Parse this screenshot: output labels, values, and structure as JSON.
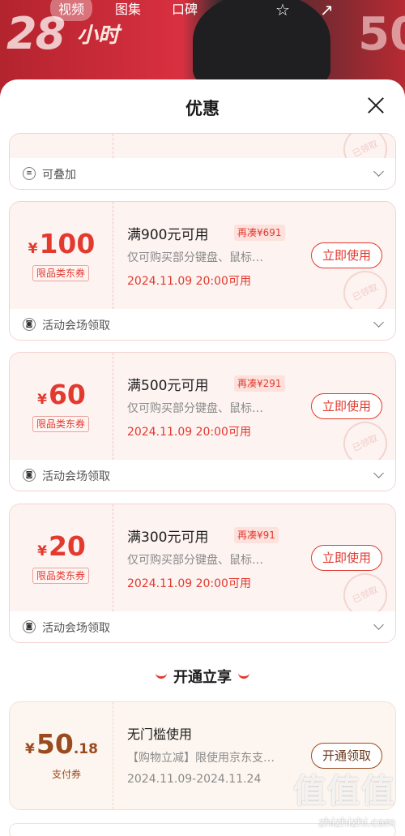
{
  "background": {
    "tabs": [
      "视频",
      "图集",
      "口碑"
    ],
    "promo_big": "28",
    "promo_sub": "小时",
    "right_number": "50"
  },
  "sheet": {
    "title": "优惠"
  },
  "top_partial": {
    "stamp": "已领取",
    "footer_text": "可叠加"
  },
  "coupons": [
    {
      "symbol": "¥",
      "amount": "100",
      "tag": "限品类东券",
      "condition": "满900元可用",
      "need": "再凑¥691",
      "desc": "仅可购买部分键盘、鼠标…",
      "date": "2024.11.09 20:00可用",
      "button": "立即使用",
      "stamp": "已领取",
      "footer_text": "活动会场领取"
    },
    {
      "symbol": "¥",
      "amount": "60",
      "tag": "限品类东券",
      "condition": "满500元可用",
      "need": "再凑¥291",
      "desc": "仅可购买部分键盘、鼠标…",
      "date": "2024.11.09 20:00可用",
      "button": "立即使用",
      "stamp": "已领取",
      "footer_text": "活动会场领取"
    },
    {
      "symbol": "¥",
      "amount": "20",
      "tag": "限品类东券",
      "condition": "满300元可用",
      "need": "再凑¥91",
      "desc": "仅可购买部分键盘、鼠标…",
      "date": "2024.11.09 20:00可用",
      "button": "立即使用",
      "stamp": "已领取",
      "footer_text": "活动会场领取"
    }
  ],
  "section2": {
    "title": "开通立享"
  },
  "pay_coupon": {
    "symbol": "¥",
    "amount_int": "50",
    "amount_dec": ".18",
    "tag": "支付券",
    "condition": "无门槛使用",
    "desc": "【购物立减】限使用京东支…",
    "date": "2024.11.09-2024.11.24",
    "button": "开通领取"
  },
  "watermark": {
    "text": "值值值",
    "url": "zhizhizhi.com"
  },
  "colors": {
    "accent": "#e23a2f",
    "coupon_bg": "#fdf3f1",
    "gold": "#9a4a1e"
  }
}
